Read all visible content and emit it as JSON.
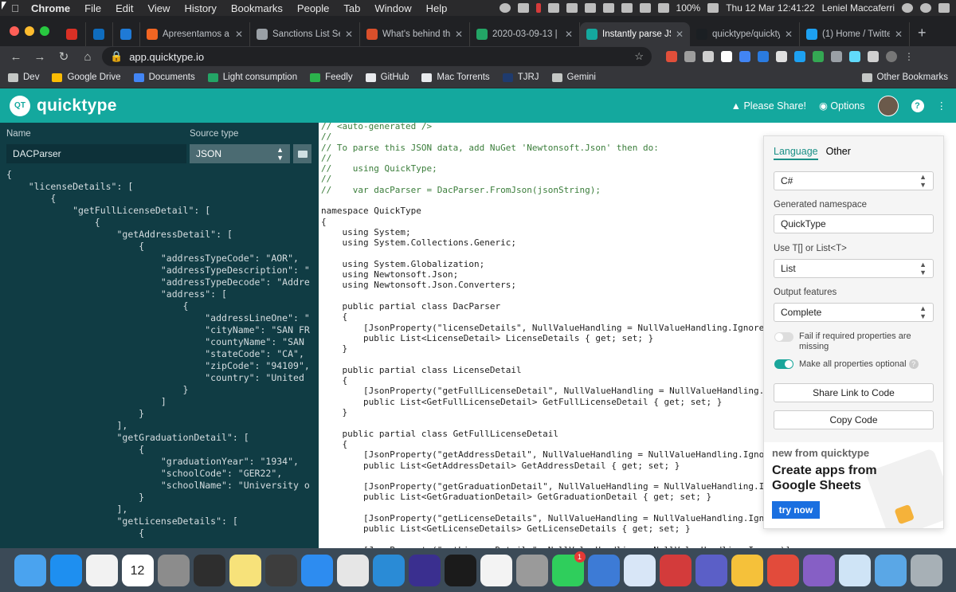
{
  "menubar": {
    "app": "Chrome",
    "items": [
      "File",
      "Edit",
      "View",
      "History",
      "Bookmarks",
      "People",
      "Tab",
      "Window",
      "Help"
    ],
    "battery": "100%",
    "clock": "Thu 12 Mar  12:41:22",
    "user": "Leniel Maccaferri"
  },
  "tabs": [
    {
      "label": "",
      "icon": "gmail-icon",
      "color": "#d93025"
    },
    {
      "label": "",
      "icon": "outlook-icon",
      "color": "#0f6cbd"
    },
    {
      "label": "",
      "icon": "azure-icon",
      "color": "#1f7ad6"
    },
    {
      "label": "Apresentamos a V",
      "icon": "globe-icon",
      "color": "#f16522"
    },
    {
      "label": "Sanctions List Sea",
      "icon": "globe-icon",
      "color": "#9aa0a6"
    },
    {
      "label": "What's behind the",
      "icon": "article-icon",
      "color": "#d94f2b"
    },
    {
      "label": "2020-03-09-13 | s",
      "icon": "sheets-icon",
      "color": "#23a566"
    },
    {
      "label": "Instantly parse JSO",
      "icon": "quicktype-icon",
      "color": "#14a89e",
      "active": true
    },
    {
      "label": "quicktype/quicktyp",
      "icon": "github-icon",
      "color": "#1b1f23"
    },
    {
      "label": "(1) Home / Twitter",
      "icon": "twitter-icon",
      "color": "#1da1f2"
    }
  ],
  "addressbar": {
    "url": "app.quicktype.io"
  },
  "bookmarks": [
    {
      "label": "Dev",
      "color": "#c4c7c5"
    },
    {
      "label": "Google Drive",
      "color": "#fbbc04"
    },
    {
      "label": "Documents",
      "color": "#4285f4"
    },
    {
      "label": "Light consumption",
      "color": "#23a566"
    },
    {
      "label": "Feedly",
      "color": "#2bb24c"
    },
    {
      "label": "GitHub",
      "color": "#e8eaed"
    },
    {
      "label": "Mac Torrents",
      "color": "#e8eaed"
    },
    {
      "label": "TJRJ",
      "color": "#1f3b6e"
    },
    {
      "label": "Gemini",
      "color": "#c4c7c5"
    }
  ],
  "other_bookmarks": "Other Bookmarks",
  "header": {
    "logo_text": "QT",
    "brand": "quicktype",
    "share": "Please Share!",
    "options": "Options",
    "help": "?"
  },
  "left": {
    "name_label": "Name",
    "name_value": "DACParser",
    "source_label": "Source type",
    "source_value": "JSON",
    "json_lines": [
      "{",
      "    \"licenseDetails\": [",
      "        {",
      "            \"getFullLicenseDetail\": [",
      "                {",
      "                    \"getAddressDetail\": [",
      "                        {",
      "                            \"addressTypeCode\": \"AOR\",",
      "                            \"addressTypeDescription\": \"",
      "                            \"addressTypeDecode\": \"Addre",
      "                            \"address\": [",
      "                                {",
      "                                    \"addressLineOne\": \"",
      "                                    \"cityName\": \"SAN FR",
      "                                    \"countyName\": \"SAN",
      "                                    \"stateCode\": \"CA\",",
      "                                    \"zipCode\": \"94109\",",
      "                                    \"country\": \"United",
      "                                }",
      "                            ]",
      "                        }",
      "                    ],",
      "                    \"getGraduationDetail\": [",
      "                        {",
      "                            \"graduationYear\": \"1934\",",
      "                            \"schoolCode\": \"GER22\",",
      "                            \"schoolName\": \"University o",
      "                        }",
      "                    ],",
      "                    \"getLicenseDetails\": [",
      "                        {"
    ]
  },
  "code_lines": [
    "// <auto-generated />",
    "//",
    "// To parse this JSON data, add NuGet 'Newtonsoft.Json' then do:",
    "//",
    "//    using QuickType;",
    "//",
    "//    var dacParser = DacParser.FromJson(jsonString);",
    "",
    "namespace QuickType",
    "{",
    "    using System;",
    "    using System.Collections.Generic;",
    "",
    "    using System.Globalization;",
    "    using Newtonsoft.Json;",
    "    using Newtonsoft.Json.Converters;",
    "",
    "    public partial class DacParser",
    "    {",
    "        [JsonProperty(\"licenseDetails\", NullValueHandling = NullValueHandling.Ignore)]",
    "        public List<LicenseDetail> LicenseDetails { get; set; }",
    "    }",
    "",
    "    public partial class LicenseDetail",
    "    {",
    "        [JsonProperty(\"getFullLicenseDetail\", NullValueHandling = NullValueHandling.Ignore)]",
    "        public List<GetFullLicenseDetail> GetFullLicenseDetail { get; set; }",
    "    }",
    "",
    "    public partial class GetFullLicenseDetail",
    "    {",
    "        [JsonProperty(\"getAddressDetail\", NullValueHandling = NullValueHandling.Ignore)]",
    "        public List<GetAddressDetail> GetAddressDetail { get; set; }",
    "",
    "        [JsonProperty(\"getGraduationDetail\", NullValueHandling = NullValueHandling.Ignore)]",
    "        public List<GetGraduationDetail> GetGraduationDetail { get; set; }",
    "",
    "        [JsonProperty(\"getLicenseDetails\", NullValueHandling = NullValueHandling.Ignore)]",
    "        public List<GetLicenseDetails> GetLicenseDetails { get; set; }",
    "",
    "        [JsonProperty(\"getLicenseDetails\", NullValueHandling = NullValueHandling.Ignore)]"
  ],
  "options": {
    "tab_language": "Language",
    "tab_other": "Other",
    "language": "C#",
    "namespace_label": "Generated namespace",
    "namespace_value": "QuickType",
    "array_label": "Use T[] or List<T>",
    "array_value": "List",
    "features_label": "Output features",
    "features_value": "Complete",
    "toggle1_label": "Fail if required properties are missing",
    "toggle1_on": false,
    "toggle2_label": "Make all properties optional",
    "toggle2_on": true,
    "share_button": "Share Link to Code",
    "copy_button": "Copy Code",
    "promo_sub": "new from quicktype",
    "promo_title": "Create apps from Google Sheets",
    "promo_button": "try now"
  },
  "dock": [
    {
      "name": "finder",
      "color": "#4aa3ef"
    },
    {
      "name": "app-store",
      "color": "#1e8ff0"
    },
    {
      "name": "photos",
      "color": "#f2f2f2"
    },
    {
      "name": "calendar",
      "color": "#ffffff",
      "label": "12"
    },
    {
      "name": "calculator",
      "color": "#8c8c8c"
    },
    {
      "name": "activity-monitor",
      "color": "#2e2e2e"
    },
    {
      "name": "notes",
      "color": "#f7e27a"
    },
    {
      "name": "sublime-text",
      "color": "#3d3d3d"
    },
    {
      "name": "safari",
      "color": "#2d8cf0"
    },
    {
      "name": "chrome",
      "color": "#e6e6e6"
    },
    {
      "name": "vscode",
      "color": "#2a8bd6"
    },
    {
      "name": "eclipse",
      "color": "#3a2f8f"
    },
    {
      "name": "terminal",
      "color": "#1b1b1b"
    },
    {
      "name": "music",
      "color": "#f3f3f3"
    },
    {
      "name": "system-preferences",
      "color": "#9a9a9a"
    },
    {
      "name": "whatsapp",
      "color": "#2fce5c",
      "badge": "1"
    },
    {
      "name": "simplenote",
      "color": "#3d7bd6"
    },
    {
      "name": "remote-desktop",
      "color": "#d8e6f7"
    },
    {
      "name": "parallels",
      "color": "#d33b3b"
    },
    {
      "name": "teams",
      "color": "#5b5fc7"
    },
    {
      "name": "file-merge",
      "color": "#f5c13a"
    },
    {
      "name": "paw",
      "color": "#e24b3b"
    },
    {
      "name": "visual-studio",
      "color": "#865fc5"
    },
    {
      "name": "preview",
      "color": "#cfe4f6"
    },
    {
      "name": "downloads",
      "color": "#5aa7e6"
    },
    {
      "name": "trash",
      "color": "#a7b0b6"
    }
  ]
}
